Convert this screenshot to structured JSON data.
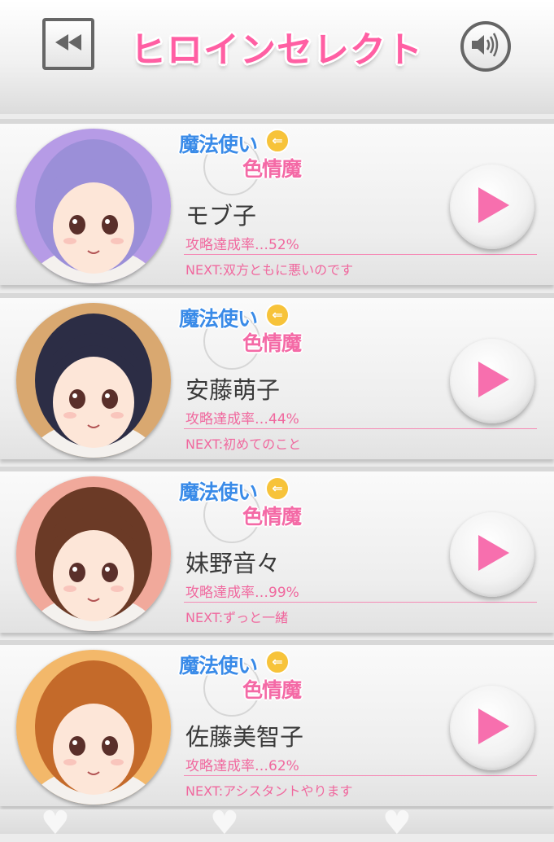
{
  "header": {
    "title": "ヒロインセレクト",
    "back_icon": "rewind-icon",
    "sound_icon": "speaker-icon"
  },
  "logo": {
    "line1": "魔法使い",
    "line2": "色情魔",
    "arrow": "⇐"
  },
  "heroines": [
    {
      "name": "モブ子",
      "rate": "攻略達成率…52%",
      "next": "NEXT:双方ともに悪いのです",
      "hair_color": "#9b8fd8",
      "bg_color": "#b69be6"
    },
    {
      "name": "安藤萌子",
      "rate": "攻略達成率…44%",
      "next": "NEXT:初めてのこと",
      "hair_color": "#2c2d45",
      "bg_color": "#d9a870"
    },
    {
      "name": "妹野音々",
      "rate": "攻略達成率…99%",
      "next": "NEXT:ずっと一緒",
      "hair_color": "#6b3a26",
      "bg_color": "#f1a99b"
    },
    {
      "name": "佐藤美智子",
      "rate": "攻略達成率…62%",
      "next": "NEXT:アシスタントやります",
      "hair_color": "#c46a2a",
      "bg_color": "#f3b86a"
    }
  ],
  "colors": {
    "accent_pink": "#f0689e",
    "title_pink": "#ff5fa3",
    "play_pink": "#f76fae"
  }
}
